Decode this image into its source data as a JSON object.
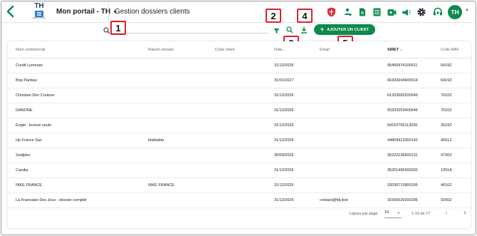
{
  "header": {
    "logo_text": "TH",
    "logo_subtext": "DEMO PORTAL",
    "portal_label": "Mon portail - TH",
    "page_title": "Gestion dossiers clients",
    "avatar_initials": "TH",
    "accent_color": "#0f8a4e"
  },
  "icons": {
    "back": "arrow-left-icon",
    "toolbar": [
      "shield-icon",
      "users-tree-icon",
      "document-icon",
      "table-icon",
      "video-icon",
      "megaphone-icon",
      "gear-icon",
      "headset-icon"
    ]
  },
  "toolbar": {
    "search_placeholder": "",
    "search_value": "",
    "add_button_label": "AJOUTER UN CLIENT"
  },
  "callouts": [
    "1",
    "2",
    "3",
    "4",
    "5"
  ],
  "table": {
    "columns": [
      "Nom commercial",
      "Raison sociale",
      "Code client",
      "Date...",
      "Email",
      "SIRET",
      "Code NAF"
    ],
    "sort_indicator": "↓",
    "rows": [
      [
        "Credit Lyonnais",
        "",
        "",
        "31/12/2026",
        "",
        "95450974100011",
        "6419Z"
      ],
      [
        "Bnp Paribas",
        "",
        "",
        "31/01/2027",
        "",
        "66204244900014",
        "6419Z"
      ],
      [
        "Christian Dior Couture",
        "",
        "",
        "31/12/2026",
        "",
        "61203583200049",
        "7010Z"
      ],
      [
        "DANONE",
        "",
        "",
        "31/12/2026",
        "",
        "55203253400646",
        "7010Z"
      ],
      [
        "Engie - lecture seule",
        "",
        "",
        "31/12/2026",
        "",
        "54210765113030",
        "3523Z"
      ],
      [
        "Hp France Sas",
        "blablabla",
        "",
        "31/12/2026",
        "",
        "44869413300142",
        "4651Z"
      ],
      [
        "Sodiplec",
        "",
        "",
        "30/09/2026",
        "",
        "35222236600131",
        "4730Z"
      ],
      [
        "Candia",
        "",
        "",
        "31/12/2026",
        "",
        "35201495500392",
        "1051A"
      ],
      [
        "NIKE FRANCE",
        "NIKE FRANCE",
        "",
        "31/12/2026",
        "",
        "32036713900195",
        "4616Z"
      ],
      [
        "La Francaise Des Jeux - dossier complet",
        "",
        "",
        "31/12/2026",
        "contact@fdj.test",
        "31506529200296",
        "9200Z"
      ]
    ]
  },
  "pagination": {
    "rows_per_page_label": "Lignes par page",
    "rows_per_page_value": "10",
    "range_label": "1-10 de 77",
    "prev": "‹",
    "next": "›"
  }
}
